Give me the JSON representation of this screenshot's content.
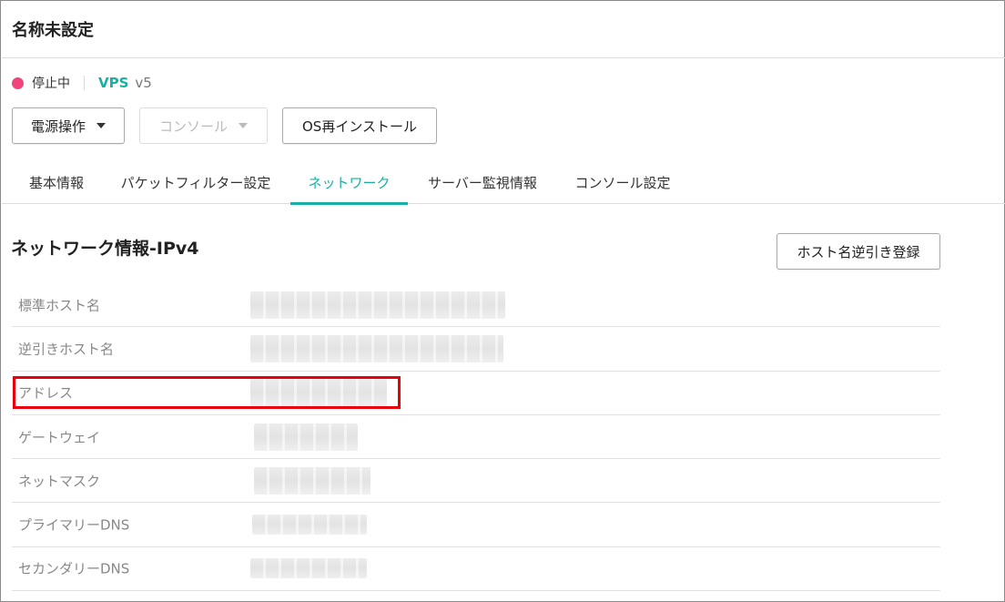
{
  "header": {
    "server_name": "名称未設定"
  },
  "status": {
    "state_label": "停止中",
    "state_color": "#f0447c",
    "plan": "VPS",
    "version": "v5"
  },
  "toolbar": {
    "power_label": "電源操作",
    "console_label": "コンソール",
    "reinstall_label": "OS再インストール"
  },
  "tabs": [
    {
      "label": "基本情報",
      "active": false
    },
    {
      "label": "パケットフィルター設定",
      "active": false
    },
    {
      "label": "ネットワーク",
      "active": true
    },
    {
      "label": "サーバー監視情報",
      "active": false
    },
    {
      "label": "コンソール設定",
      "active": false
    }
  ],
  "network": {
    "title": "ネットワーク情報-IPv4",
    "rdns_button_label": "ホスト名逆引き登録",
    "rows": [
      {
        "label": "標準ホスト名",
        "value": ""
      },
      {
        "label": "逆引きホスト名",
        "value": ""
      },
      {
        "label": "アドレス",
        "value": ""
      },
      {
        "label": "ゲートウェイ",
        "value": ""
      },
      {
        "label": "ネットマスク",
        "value": ""
      },
      {
        "label": "プライマリーDNS",
        "value": ""
      },
      {
        "label": "セカンダリーDNS",
        "value": ""
      }
    ]
  },
  "colors": {
    "accent": "#19b0a4",
    "highlight": "#e8000c",
    "stopped": "#f0447c"
  }
}
